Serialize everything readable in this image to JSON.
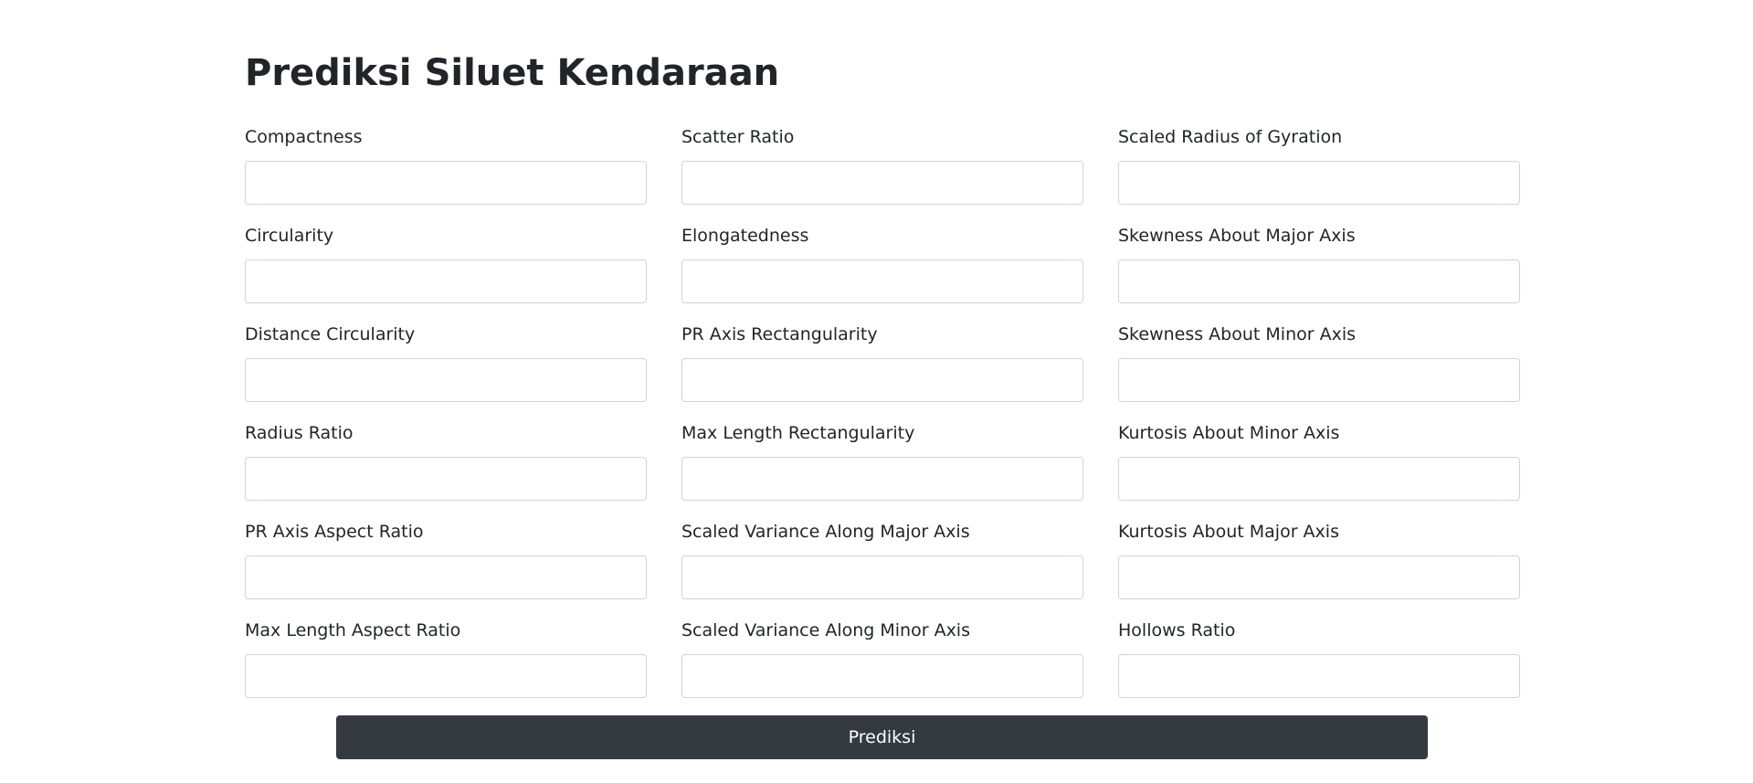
{
  "page": {
    "title": "Prediksi Siluet Kendaraan"
  },
  "form": {
    "fields": [
      {
        "label": "Compactness",
        "value": "",
        "placeholder": ""
      },
      {
        "label": "Scatter Ratio",
        "value": "",
        "placeholder": ""
      },
      {
        "label": "Scaled Radius of Gyration",
        "value": "",
        "placeholder": ""
      },
      {
        "label": "Circularity",
        "value": "",
        "placeholder": ""
      },
      {
        "label": "Elongatedness",
        "value": "",
        "placeholder": ""
      },
      {
        "label": "Skewness About Major Axis",
        "value": "",
        "placeholder": ""
      },
      {
        "label": "Distance Circularity",
        "value": "",
        "placeholder": ""
      },
      {
        "label": "PR Axis Rectangularity",
        "value": "",
        "placeholder": ""
      },
      {
        "label": "Skewness About Minor Axis",
        "value": "",
        "placeholder": ""
      },
      {
        "label": "Radius Ratio",
        "value": "",
        "placeholder": ""
      },
      {
        "label": "Max Length Rectangularity",
        "value": "",
        "placeholder": ""
      },
      {
        "label": "Kurtosis About Minor Axis",
        "value": "",
        "placeholder": ""
      },
      {
        "label": "PR Axis Aspect Ratio",
        "value": "",
        "placeholder": ""
      },
      {
        "label": "Scaled Variance Along Major Axis",
        "value": "",
        "placeholder": ""
      },
      {
        "label": "Kurtosis About Major Axis",
        "value": "",
        "placeholder": ""
      },
      {
        "label": "Max Length Aspect Ratio",
        "value": "",
        "placeholder": ""
      },
      {
        "label": "Scaled Variance Along Minor Axis",
        "value": "",
        "placeholder": ""
      },
      {
        "label": "Hollows Ratio",
        "value": "",
        "placeholder": ""
      }
    ],
    "submit_label": "Prediksi"
  },
  "colors": {
    "button_bg": "#343a40",
    "button_text": "#ffffff",
    "input_border": "#ced4da",
    "text": "#212529"
  }
}
